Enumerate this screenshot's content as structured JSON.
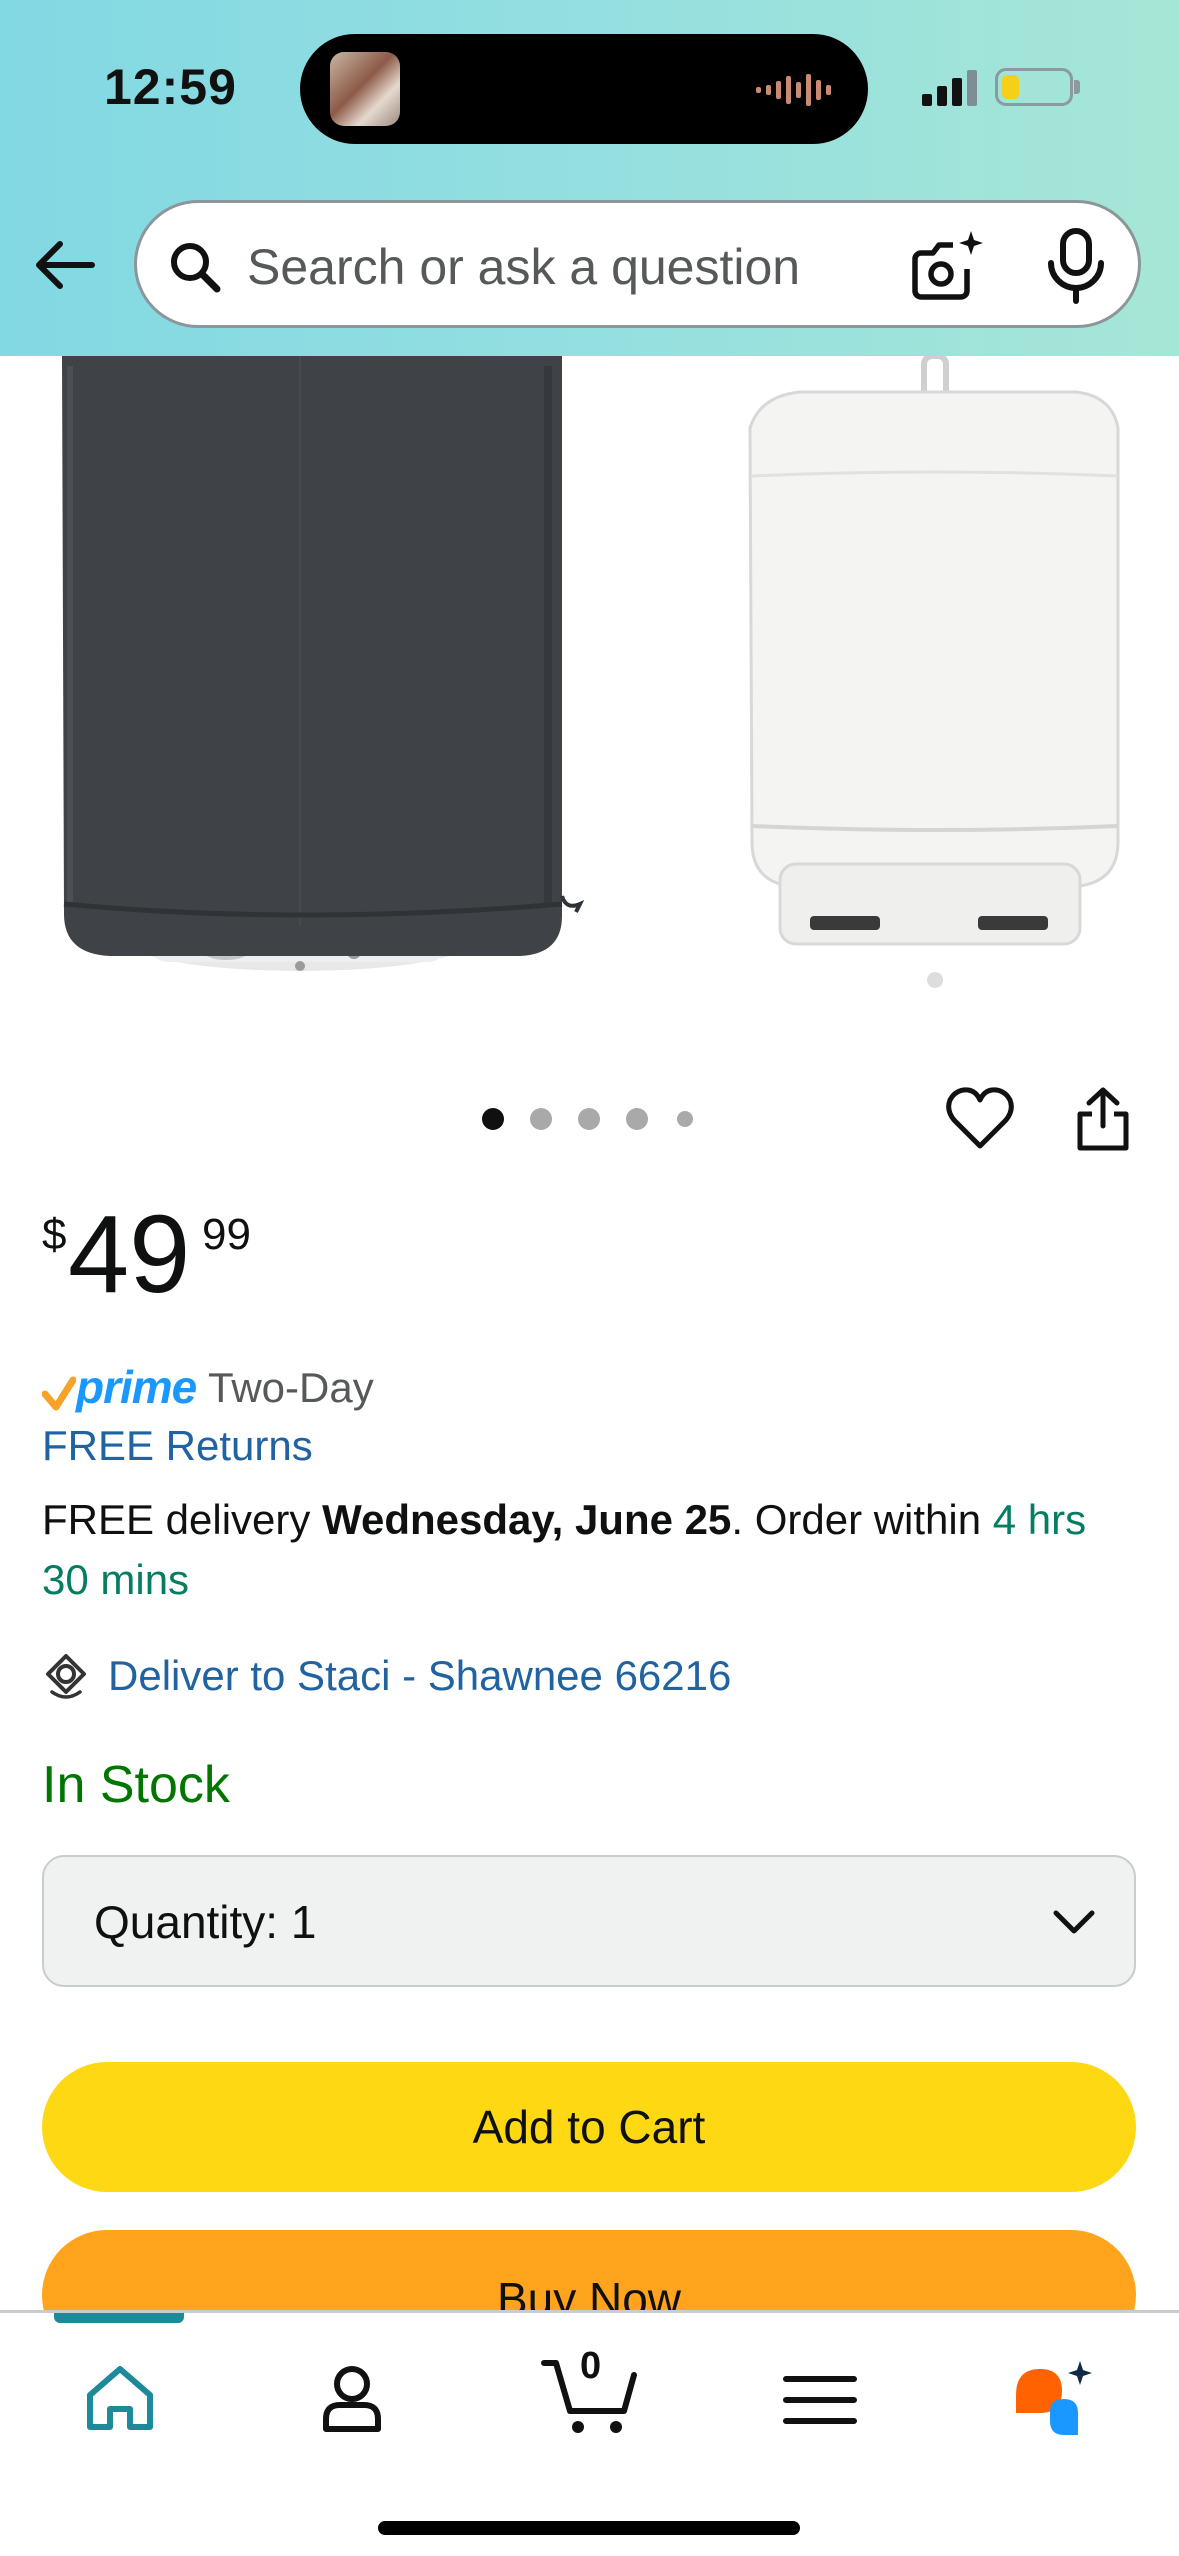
{
  "status_bar": {
    "time": "12:59",
    "battery_level": 0.25,
    "battery_color": "#f5cf18"
  },
  "search": {
    "placeholder": "Search or ask a question",
    "icons": [
      "back-arrow-icon",
      "search-icon",
      "camera-sparkle-icon",
      "microphone-icon"
    ]
  },
  "gallery": {
    "dot_count": 5,
    "active_index": 0,
    "actions": [
      "heart-icon",
      "share-icon"
    ]
  },
  "price": {
    "symbol": "$",
    "whole": "49",
    "fraction": "99"
  },
  "delivery": {
    "prime_label": "prime",
    "prime_speed": "Two-Day",
    "free_returns": "FREE Returns",
    "prefix": "FREE delivery ",
    "date": "Wednesday, June 25",
    "order_within": ". Order within ",
    "countdown": "4 hrs 30 mins",
    "deliver_to": "Deliver to Staci - Shawnee 66216"
  },
  "stock": {
    "status": "In Stock"
  },
  "quantity": {
    "label": "Quantity:",
    "value": "1"
  },
  "actions": {
    "add_to_cart": "Add to Cart",
    "buy_now": "Buy Now"
  },
  "bottom_nav": {
    "cart_count": "0",
    "items": [
      "home-icon",
      "account-icon",
      "cart-icon",
      "menu-icon",
      "rufus-icon"
    ],
    "active": "home"
  },
  "colors": {
    "header_gradient_start": "#82d8e3",
    "header_gradient_end": "#a6e6d6",
    "link_blue": "#2162a1",
    "prime_blue": "#1a98ff",
    "in_stock_green": "#007600",
    "countdown_teal": "#067d62",
    "add_to_cart_yellow": "#ffd814",
    "buy_now_orange": "#ffa41c",
    "nav_active_teal": "#1d8a99"
  }
}
